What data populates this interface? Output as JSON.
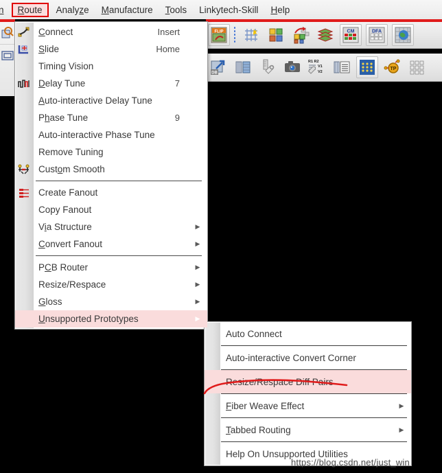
{
  "menubar": {
    "items": [
      {
        "name": "menubar-item-clipped",
        "prefix": "",
        "mnemonic": "n",
        "suffix": "",
        "boxed": false,
        "clipped": true
      },
      {
        "name": "menubar-item-route",
        "prefix": "",
        "mnemonic": "R",
        "suffix": "oute",
        "boxed": true,
        "clipped": false
      },
      {
        "name": "menubar-item-analyze",
        "prefix": "Analy",
        "mnemonic": "z",
        "suffix": "e",
        "boxed": false,
        "clipped": false
      },
      {
        "name": "menubar-item-manufacture",
        "prefix": "",
        "mnemonic": "M",
        "suffix": "anufacture",
        "boxed": false,
        "clipped": false
      },
      {
        "name": "menubar-item-tools",
        "prefix": "",
        "mnemonic": "T",
        "suffix": "ools",
        "boxed": false,
        "clipped": false
      },
      {
        "name": "menubar-item-linkytech-skill",
        "prefix": "Linkytech-Skill",
        "mnemonic": "",
        "suffix": "",
        "boxed": false,
        "clipped": false
      },
      {
        "name": "menubar-item-help",
        "prefix": "",
        "mnemonic": "H",
        "suffix": "elp",
        "boxed": false,
        "clipped": false
      }
    ]
  },
  "route_menu": {
    "rows": [
      {
        "type": "item",
        "name": "menu-item-connect",
        "icon": "connect-icon",
        "prefix": "",
        "mnemonic": "C",
        "suffix": "onnect",
        "accel": "Insert",
        "arrow": false,
        "highlight": false
      },
      {
        "type": "item",
        "name": "menu-item-slide",
        "icon": "slide-icon",
        "prefix": "",
        "mnemonic": "S",
        "suffix": "lide",
        "accel": "Home",
        "arrow": false,
        "highlight": false
      },
      {
        "type": "item",
        "name": "menu-item-timing-vision",
        "icon": "",
        "prefix": "Timing Vision",
        "mnemonic": "",
        "suffix": "",
        "accel": "",
        "arrow": false,
        "highlight": false
      },
      {
        "type": "item",
        "name": "menu-item-delay-tune",
        "icon": "delay-tune-icon",
        "prefix": "",
        "mnemonic": "D",
        "suffix": "elay Tune",
        "accel": "7",
        "arrow": false,
        "highlight": false
      },
      {
        "type": "item",
        "name": "menu-item-auto-interactive-delay-tune",
        "icon": "",
        "prefix": "",
        "mnemonic": "A",
        "suffix": "uto-interactive Delay Tune",
        "accel": "",
        "arrow": false,
        "highlight": false
      },
      {
        "type": "item",
        "name": "menu-item-phase-tune",
        "icon": "",
        "prefix": "P",
        "mnemonic": "h",
        "suffix": "ase Tune",
        "accel": "9",
        "arrow": false,
        "highlight": false
      },
      {
        "type": "item",
        "name": "menu-item-auto-interactive-phase-tune",
        "icon": "",
        "prefix": "Auto-interactive Phase Tune",
        "mnemonic": "",
        "suffix": "",
        "accel": "",
        "arrow": false,
        "highlight": false
      },
      {
        "type": "item",
        "name": "menu-item-remove-tuning",
        "icon": "",
        "prefix": "Remove Tuning",
        "mnemonic": "",
        "suffix": "",
        "accel": "",
        "arrow": false,
        "highlight": false
      },
      {
        "type": "item",
        "name": "menu-item-custom-smooth",
        "icon": "custom-smooth-icon",
        "prefix": "Cust",
        "mnemonic": "o",
        "suffix": "m Smooth",
        "accel": "",
        "arrow": false,
        "highlight": false
      },
      {
        "type": "separator",
        "name": "menu-separator-1"
      },
      {
        "type": "item",
        "name": "menu-item-create-fanout",
        "icon": "create-fanout-icon",
        "prefix": "Create Fanout",
        "mnemonic": "",
        "suffix": "",
        "accel": "",
        "arrow": false,
        "highlight": false
      },
      {
        "type": "item",
        "name": "menu-item-copy-fanout",
        "icon": "",
        "prefix": "Copy Fanout",
        "mnemonic": "",
        "suffix": "",
        "accel": "",
        "arrow": false,
        "highlight": false
      },
      {
        "type": "item",
        "name": "menu-item-via-structure",
        "icon": "",
        "prefix": "V",
        "mnemonic": "i",
        "suffix": "a Structure",
        "accel": "",
        "arrow": true,
        "highlight": false
      },
      {
        "type": "item",
        "name": "menu-item-convert-fanout",
        "icon": "",
        "prefix": "",
        "mnemonic": "C",
        "suffix": "onvert Fanout",
        "accel": "",
        "arrow": true,
        "highlight": false
      },
      {
        "type": "separator",
        "name": "menu-separator-2"
      },
      {
        "type": "item",
        "name": "menu-item-pcb-router",
        "icon": "",
        "prefix": "P",
        "mnemonic": "C",
        "suffix": "B Router",
        "accel": "",
        "arrow": true,
        "highlight": false
      },
      {
        "type": "item",
        "name": "menu-item-resize-respace",
        "icon": "",
        "prefix": "Resize/Respace",
        "mnemonic": "",
        "suffix": "",
        "accel": "",
        "arrow": true,
        "highlight": false
      },
      {
        "type": "item",
        "name": "menu-item-gloss",
        "icon": "",
        "prefix": "",
        "mnemonic": "G",
        "suffix": "loss",
        "accel": "",
        "arrow": true,
        "highlight": false
      },
      {
        "type": "item",
        "name": "menu-item-unsupported-prototypes",
        "icon": "",
        "prefix": "",
        "mnemonic": "U",
        "suffix": "nsupported Prototypes",
        "accel": "",
        "arrow": true,
        "highlight": true
      }
    ]
  },
  "submenu": {
    "rows": [
      {
        "type": "item",
        "name": "submenu-item-auto-connect",
        "prefix": "Auto Connect",
        "mnemonic": "",
        "suffix": "",
        "arrow": false,
        "highlight": false
      },
      {
        "type": "separator",
        "name": "submenu-separator-1"
      },
      {
        "type": "item",
        "name": "submenu-item-auto-interactive-convert-corner",
        "prefix": "Auto-interactive Convert Corner",
        "mnemonic": "",
        "suffix": "",
        "arrow": false,
        "highlight": false
      },
      {
        "type": "separator",
        "name": "submenu-separator-2"
      },
      {
        "type": "item",
        "name": "submenu-item-resize-respace-diff-pairs",
        "prefix": "Resize/Respace Diff Pairs",
        "mnemonic": "",
        "suffix": "",
        "arrow": false,
        "highlight": true
      },
      {
        "type": "separator",
        "name": "submenu-separator-3"
      },
      {
        "type": "item",
        "name": "submenu-item-fiber-weave-effect",
        "prefix": "",
        "mnemonic": "F",
        "suffix": "iber Weave Effect",
        "arrow": true,
        "highlight": false
      },
      {
        "type": "separator",
        "name": "submenu-separator-4"
      },
      {
        "type": "item",
        "name": "submenu-item-tabbed-routing",
        "prefix": "",
        "mnemonic": "T",
        "suffix": "abbed Routing",
        "arrow": true,
        "highlight": false
      },
      {
        "type": "separator",
        "name": "submenu-separator-5"
      },
      {
        "type": "item",
        "name": "submenu-item-help-on-unsupported-utilities",
        "prefix": "Help On Unsupported Utilities",
        "mnemonic": "",
        "suffix": "",
        "arrow": false,
        "highlight": false
      }
    ]
  },
  "left_toolbar": {
    "buttons": [
      {
        "name": "zoom-tool-icon"
      },
      {
        "name": "rectangle-tool-icon"
      }
    ]
  },
  "toolbar_row_1": {
    "buttons": [
      {
        "name": "flip-icon",
        "label": "FLIP"
      },
      {
        "name": "grid-sparkle-icon",
        "label": ""
      },
      {
        "name": "color-squares-icon",
        "label": ""
      },
      {
        "name": "placement-move-icon",
        "label": ""
      },
      {
        "name": "layer-stack-icon",
        "label": ""
      },
      {
        "name": "cm-table-icon",
        "label": "CM"
      },
      {
        "name": "dfa-table-icon",
        "label": "DFA"
      },
      {
        "name": "globe-grid-icon",
        "label": ""
      }
    ]
  },
  "toolbar_row_2": {
    "buttons": [
      {
        "name": "db-export-icon",
        "label": "DB"
      },
      {
        "name": "board-layers-icon",
        "label": ""
      },
      {
        "name": "measure-wrench-icon",
        "label": ""
      },
      {
        "name": "camera-snapshot-icon",
        "label": ""
      },
      {
        "name": "ref-des-wrench-icon",
        "label": "R1 R2 / V1 V2"
      },
      {
        "name": "report-list-icon",
        "label": ""
      },
      {
        "name": "via-array-icon",
        "label": ""
      },
      {
        "name": "test-point-icon",
        "label": "TP"
      },
      {
        "name": "pad-grid-icon",
        "label": ""
      }
    ]
  },
  "annotation": {
    "name": "red-underline-annotation",
    "color": "#e01b1b"
  },
  "watermark": {
    "text": "https://blog.csdn.net/just_win"
  },
  "colors": {
    "highlight_pink": "#fadcdc",
    "annotation_red": "#e01b1b",
    "canvas_black": "#000000",
    "menu_bg": "#ffffff"
  }
}
